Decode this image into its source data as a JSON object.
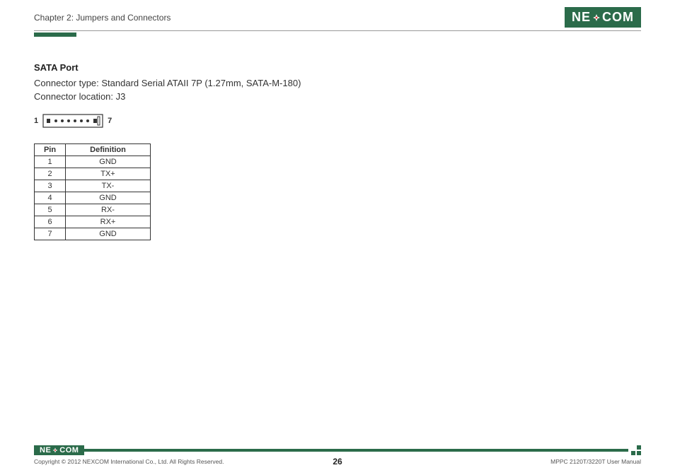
{
  "header": {
    "chapter": "Chapter 2: Jumpers and Connectors",
    "logo_text_left": "NE",
    "logo_text_right": "COM"
  },
  "section": {
    "title": "SATA Port",
    "connector_type": "Connector type: Standard Serial ATAII 7P (1.27mm, SATA-M-180)",
    "connector_location": "Connector location: J3"
  },
  "diagram": {
    "left_pin": "1",
    "right_pin": "7"
  },
  "table": {
    "headers": [
      "Pin",
      "Definition"
    ],
    "rows": [
      {
        "pin": "1",
        "def": "GND"
      },
      {
        "pin": "2",
        "def": "TX+"
      },
      {
        "pin": "3",
        "def": "TX-"
      },
      {
        "pin": "4",
        "def": "GND"
      },
      {
        "pin": "5",
        "def": "RX-"
      },
      {
        "pin": "6",
        "def": "RX+"
      },
      {
        "pin": "7",
        "def": "GND"
      }
    ]
  },
  "footer": {
    "copyright": "Copyright © 2012 NEXCOM International Co., Ltd. All Rights Reserved.",
    "page": "26",
    "manual": "MPPC 2120T/3220T User Manual",
    "logo_text_left": "NE",
    "logo_text_right": "COM"
  }
}
